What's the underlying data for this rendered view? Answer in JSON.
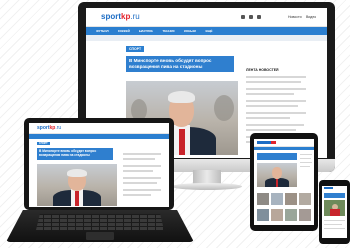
{
  "site": {
    "logo_sport": "sport",
    "logo_kp": "kp",
    "logo_tld": ".ru",
    "nav_items": [
      "ФУТБОЛ",
      "ХОККЕЙ",
      "БИАТЛОН",
      "ТЕННИС",
      "КОНЬКИ",
      "ЕЩЁ"
    ],
    "header_right": [
      "Новости",
      "Видео"
    ],
    "section_tag": "СПОРТ",
    "headline_monitor": "В Минспорте вновь обсудят вопрос возвращения пива на стадионы",
    "headline_laptop": "В Минспорте вновь обсудят вопрос возвращения пива на стадионы",
    "sidebar_title": "ЛЕНТА НОВОСТЕЙ"
  },
  "colors": {
    "brand_blue": "#2b7fd0",
    "brand_red": "#e2242c",
    "tie_red": "#c8242b",
    "suit": "#1e2a3b"
  }
}
